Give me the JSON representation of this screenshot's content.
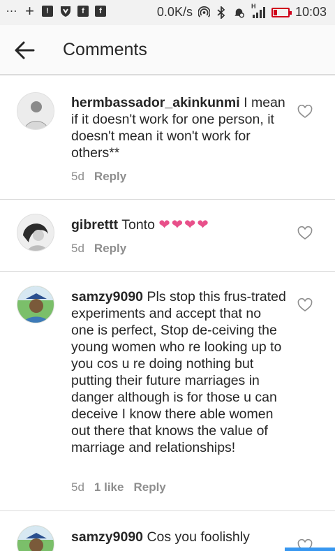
{
  "status_bar": {
    "icons_left": [
      "more-icon",
      "plus-icon",
      "alert-icon",
      "shield-icon",
      "facebook-icon",
      "facebook-icon"
    ],
    "speed": "0.0K/s",
    "network_indicator": "H",
    "time": "10:03",
    "battery_color": "#d0021b"
  },
  "header": {
    "title": "Comments"
  },
  "comments": [
    {
      "username": "hermbassador_akinkunmi",
      "text": "I mean if it doesn't work for one person, it doesn't mean it won't work for others**",
      "time": "5d",
      "likes": "",
      "reply": "Reply"
    },
    {
      "username": "gibrettt",
      "text": "Tonto",
      "hearts": "❤❤❤❤",
      "time": "5d",
      "likes": "",
      "reply": "Reply"
    },
    {
      "username": "samzy9090",
      "text": "Pls stop this frus-trated experiments and accept that no one is perfect, Stop de-ceiving the young women who re looking up to you cos u re doing nothing but putting their future marriages in danger although is for those u can deceive I know there able women out there that knows the value of marriage and relationships!",
      "time": "5d",
      "likes": "1 like",
      "reply": "Reply"
    },
    {
      "username": "samzy9090",
      "text": "Cos you foolishly",
      "time": "",
      "likes": "",
      "reply": ""
    }
  ],
  "colors": {
    "accent": "#3897f0",
    "heart": "#e8508a",
    "secondary_text": "#8e8e8e"
  }
}
